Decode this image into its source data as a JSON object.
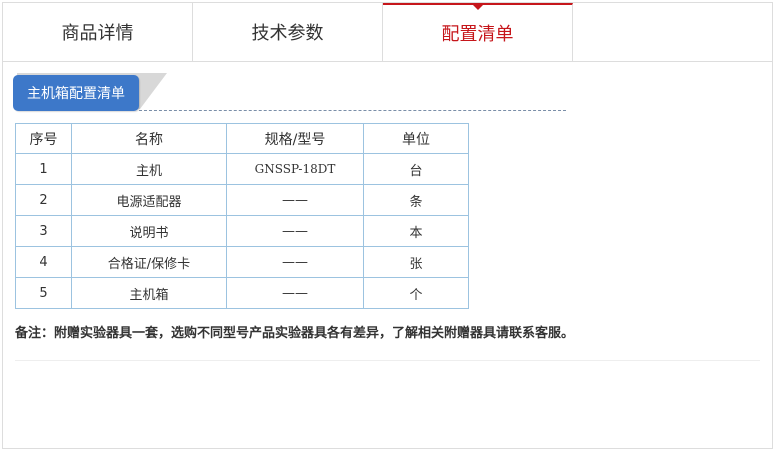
{
  "tabs": [
    {
      "label": "商品详情",
      "active": false
    },
    {
      "label": "技术参数",
      "active": false
    },
    {
      "label": "配置清单",
      "active": true
    }
  ],
  "section": {
    "title": "主机箱配置清单"
  },
  "table": {
    "headers": [
      "序号",
      "名称",
      "规格/型号",
      "单位"
    ],
    "rows": [
      [
        "1",
        "主机",
        "GNSSP-18DT",
        "台"
      ],
      [
        "2",
        "电源适配器",
        "——",
        "条"
      ],
      [
        "3",
        "说明书",
        "——",
        "本"
      ],
      [
        "4",
        "合格证/保修卡",
        "——",
        "张"
      ],
      [
        "5",
        "主机箱",
        "——",
        "个"
      ]
    ]
  },
  "note": "备注：附赠实验器具一套，选购不同型号产品实验器具各有差异，了解相关附赠器具请联系客服。",
  "colors": {
    "accent": "#c6161b",
    "section_tab": "#3d78c9",
    "table_border": "#9cc3e0"
  }
}
